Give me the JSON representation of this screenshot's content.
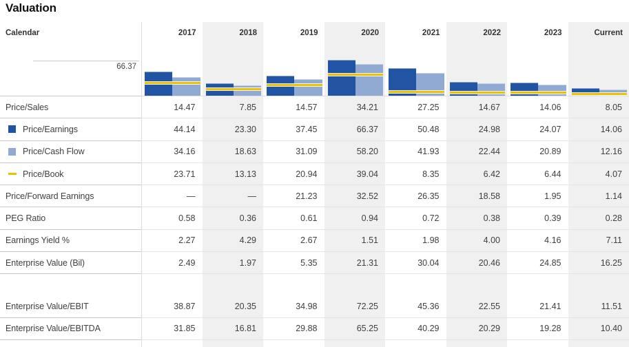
{
  "title": "Valuation",
  "header": {
    "label": "Calendar",
    "columns": [
      "2017",
      "2018",
      "2019",
      "2020",
      "2021",
      "2022",
      "2023",
      "Current"
    ]
  },
  "colors": {
    "price_earnings_bar": "#2155a4",
    "price_cash_flow_bar": "#91aad3",
    "price_book_line": "#ecc200",
    "column_stripe": "#f0f0f0"
  },
  "chart_data": {
    "type": "bar",
    "categories": [
      "2017",
      "2018",
      "2019",
      "2020",
      "2021",
      "2022",
      "2023",
      "Current"
    ],
    "series": [
      {
        "name": "Price/Earnings",
        "style": "bar",
        "color": "#2155a4",
        "values": [
          44.14,
          23.3,
          37.45,
          66.37,
          50.48,
          24.98,
          24.07,
          14.06
        ]
      },
      {
        "name": "Price/Cash Flow",
        "style": "bar",
        "color": "#91aad3",
        "values": [
          34.16,
          18.63,
          31.09,
          58.2,
          41.93,
          22.44,
          20.89,
          12.16
        ]
      },
      {
        "name": "Price/Book",
        "style": "line-marker",
        "color": "#ecc200",
        "values": [
          23.71,
          13.13,
          20.94,
          39.04,
          8.35,
          6.42,
          6.44,
          4.07
        ]
      }
    ],
    "title": "Valuation",
    "xlabel": "Calendar",
    "ylabel": "",
    "ylim": [
      0,
      66.37
    ],
    "axis_max_label": "66.37",
    "grid": false,
    "legend_position": "left-row-labels"
  },
  "rows": [
    {
      "label": "Price/Sales",
      "values": [
        "14.47",
        "7.85",
        "14.57",
        "34.21",
        "27.25",
        "14.67",
        "14.06",
        "8.05"
      ]
    },
    {
      "label": "Price/Earnings",
      "legend": {
        "shape": "square",
        "color": "#2155a4"
      },
      "values": [
        "44.14",
        "23.30",
        "37.45",
        "66.37",
        "50.48",
        "24.98",
        "24.07",
        "14.06"
      ]
    },
    {
      "label": "Price/Cash Flow",
      "legend": {
        "shape": "square",
        "color": "#91aad3"
      },
      "values": [
        "34.16",
        "18.63",
        "31.09",
        "58.20",
        "41.93",
        "22.44",
        "20.89",
        "12.16"
      ]
    },
    {
      "label": "Price/Book",
      "legend": {
        "shape": "dash",
        "color": "#ecc200"
      },
      "values": [
        "23.71",
        "13.13",
        "20.94",
        "39.04",
        "8.35",
        "6.42",
        "6.44",
        "4.07"
      ]
    },
    {
      "label": "Price/Forward Earnings",
      "values": [
        "—",
        "—",
        "21.23",
        "32.52",
        "26.35",
        "18.58",
        "1.95",
        "1.14"
      ]
    },
    {
      "label": "PEG Ratio",
      "values": [
        "0.58",
        "0.36",
        "0.61",
        "0.94",
        "0.72",
        "0.38",
        "0.39",
        "0.28"
      ]
    },
    {
      "label": "Earnings Yield %",
      "values": [
        "2.27",
        "4.29",
        "2.67",
        "1.51",
        "1.98",
        "4.00",
        "4.16",
        "7.11"
      ]
    },
    {
      "label": "Enterprise Value (Bil)",
      "values": [
        "2.49",
        "1.97",
        "5.35",
        "21.31",
        "30.04",
        "20.46",
        "24.85",
        "16.25"
      ]
    },
    {
      "label": "",
      "spacer": true,
      "values": [
        "",
        "",
        "",
        "",
        "",
        "",
        "",
        ""
      ]
    },
    {
      "label": "Enterprise Value/EBIT",
      "values": [
        "38.87",
        "20.35",
        "34.98",
        "72.25",
        "45.36",
        "22.55",
        "21.41",
        "11.51"
      ]
    },
    {
      "label": "Enterprise Value/EBITDA",
      "values": [
        "31.85",
        "16.81",
        "29.88",
        "65.25",
        "40.29",
        "20.29",
        "19.28",
        "10.40"
      ]
    }
  ]
}
